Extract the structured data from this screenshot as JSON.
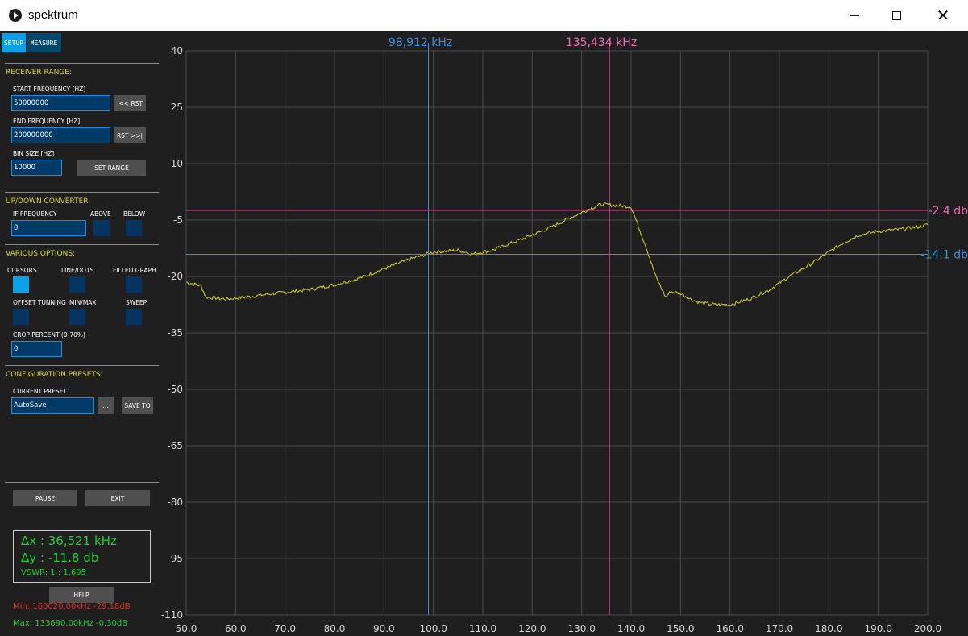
{
  "window": {
    "title": "spektrum",
    "minimize_icon": "minimize-icon",
    "maximize_icon": "maximize-icon",
    "close_icon": "close-icon",
    "close_glyph": "✕"
  },
  "tabs": [
    {
      "label": "SETUP",
      "active": true
    },
    {
      "label": "MEASURE",
      "active": false
    }
  ],
  "receiver_range": {
    "section_title": "RECEIVER RANGE:",
    "start_label": "START FREQUENCY [HZ]",
    "start_value": "50000000",
    "start_reset": "|<< RST",
    "end_label": "END FREQUENCY [HZ]",
    "end_value": "200000000",
    "end_reset": "RST >>|",
    "bin_label": "BIN SIZE [HZ]",
    "bin_value": "10000",
    "set_range": "SET RANGE"
  },
  "converter": {
    "section_title": "UP/DOWN CONVERTER:",
    "if_label": "IF FREQUENCY",
    "if_value": "0",
    "above_label": "ABOVE",
    "below_label": "BELOW",
    "above_on": false,
    "below_on": false
  },
  "options": {
    "section_title": "VARIOUS OPTIONS:",
    "cursors_label": "CURSORS",
    "cursors_on": true,
    "linedots_label": "LINE/DOTS",
    "linedots_on": false,
    "filled_label": "FILLED GRAPH",
    "filled_on": false,
    "offset_label": "OFFSET TUNNING",
    "offset_on": false,
    "minmax_label": "MIN/MAX",
    "minmax_on": false,
    "sweep_label": "SWEEP",
    "sweep_on": false,
    "crop_label": "CROP PERCENT (0-70%)",
    "crop_value": "0"
  },
  "presets": {
    "section_title": "CONFIGURATION PRESETS:",
    "current_label": "CURRENT PRESET",
    "current_value": "AutoSave",
    "browse": "...",
    "save_to": "SAVE TO"
  },
  "controls": {
    "pause": "PAUSE",
    "exit": "EXIT",
    "help": "HELP"
  },
  "readout": {
    "dx": "Δx : 36,521 kHz",
    "dy": "Δy : -11.8 db",
    "vswr": "VSWR: 1 : 1.695",
    "min": "Min: 160020.00kHz -29.18dB",
    "max": "Max: 133690.00kHz -0.30dB"
  },
  "colors": {
    "background": "#1f1f20",
    "grid": "#4a4a4a",
    "trace": "#c6c62a",
    "cursor1": "#3a8fe0",
    "cursor2": "#f06bb4",
    "accent": "#0aa1e6",
    "ok_green": "#1fd12f",
    "min_red": "#d23a21"
  },
  "chart_data": {
    "type": "line",
    "xlim": [
      50.0,
      200.0
    ],
    "ylim": [
      -110,
      40
    ],
    "xticks": [
      50.0,
      60.0,
      70.0,
      80.0,
      90.0,
      100.0,
      110.0,
      120.0,
      130.0,
      140.0,
      150.0,
      160.0,
      170.0,
      180.0,
      190.0,
      200.0
    ],
    "xtick_labels": [
      "50.0",
      "60.0",
      "70.0",
      "80.0",
      "90.0",
      "100.0",
      "110.0",
      "120.0",
      "130.0",
      "140.0",
      "150.0",
      "160.0",
      "170.0",
      "180.0",
      "190.0",
      "200.0"
    ],
    "yticks": [
      40,
      25,
      10,
      -5,
      -20,
      -35,
      -50,
      -65,
      -80,
      -95,
      -110
    ],
    "ytick_labels": [
      "40",
      "25",
      "10",
      "-5",
      "-20",
      "-35",
      "-50",
      "-65",
      "-80",
      "-95",
      "-110"
    ],
    "grid": true,
    "x": [
      50,
      53,
      54,
      58,
      62,
      66,
      70,
      75,
      80,
      85,
      90,
      95,
      100,
      105,
      108,
      112,
      116,
      120,
      124,
      127,
      130,
      132,
      134,
      136,
      138,
      140,
      141,
      143,
      145,
      147,
      148,
      150,
      152,
      154,
      157,
      160,
      164,
      168,
      172,
      176,
      180,
      183,
      186,
      190,
      194,
      198,
      200
    ],
    "y": [
      -21.5,
      -22.5,
      -25.5,
      -26.0,
      -25.5,
      -24.8,
      -24.2,
      -23.5,
      -22.2,
      -20.5,
      -18.0,
      -15.5,
      -13.5,
      -13.0,
      -14.0,
      -13.0,
      -11.0,
      -9.0,
      -6.8,
      -4.8,
      -3.0,
      -1.8,
      -0.8,
      -1.0,
      -1.2,
      -1.5,
      -5.0,
      -12.0,
      -20.0,
      -25.5,
      -24.0,
      -24.5,
      -26.0,
      -27.0,
      -27.5,
      -27.5,
      -26.0,
      -23.5,
      -20.0,
      -17.0,
      -13.5,
      -11.0,
      -9.0,
      -8.0,
      -7.5,
      -6.8,
      -6.2
    ],
    "cursors": [
      {
        "label": "98,912 kHz",
        "x": 99.0,
        "color": "#3a8fe0"
      },
      {
        "label": "135,434 kHz",
        "x": 135.6,
        "color": "#f06bb4"
      }
    ],
    "hlines": [
      {
        "label": "-2.4 db",
        "y": -2.4,
        "color": "#f06bb4"
      },
      {
        "label": "-14.1 db",
        "y": -14.1,
        "color": "#3a8fe0"
      }
    ]
  }
}
